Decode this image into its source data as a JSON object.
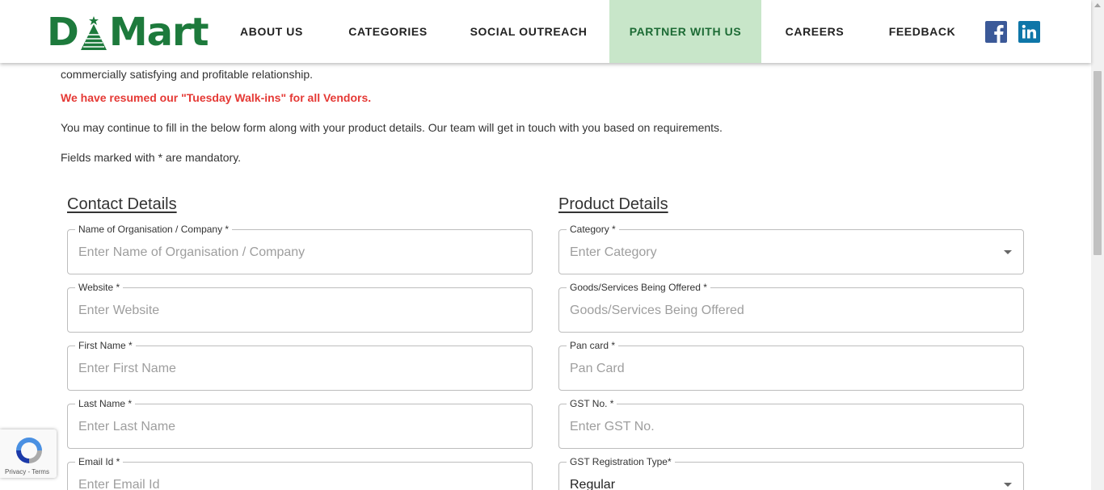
{
  "brand": {
    "logo_left": "D",
    "logo_right": "Mart",
    "primary_color": "#1d7a3c"
  },
  "nav": {
    "items": [
      "ABOUT US",
      "CATEGORIES",
      "SOCIAL OUTREACH",
      "PARTNER WITH US",
      "CAREERS",
      "FEEDBACK"
    ],
    "active": "PARTNER WITH US",
    "active_bg": "#c8e6c9"
  },
  "social": {
    "facebook_icon": "facebook-icon",
    "linkedin_icon": "linkedin-icon",
    "facebook_color": "#3b5998",
    "linkedin_color": "#0e76a8"
  },
  "intro": {
    "line_partial": "commercially satisfying and profitable relationship.",
    "notice": "We have resumed our \"Tuesday Walk-ins\" for all Vendors.",
    "instructions": "You may continue to fill in the below form along with your product details. Our team will get in touch with you based on requirements.",
    "mandatory_note": "Fields marked with * are mandatory."
  },
  "contact_details": {
    "title": "Contact Details",
    "fields": [
      {
        "label": "Name of Organisation / Company *",
        "placeholder": "Enter Name of Organisation / Company",
        "value": ""
      },
      {
        "label": "Website *",
        "placeholder": "Enter Website",
        "value": ""
      },
      {
        "label": "First Name *",
        "placeholder": "Enter First Name",
        "value": ""
      },
      {
        "label": "Last Name *",
        "placeholder": "Enter Last Name",
        "value": ""
      },
      {
        "label": "Email Id *",
        "placeholder": "Enter Email Id",
        "value": ""
      }
    ]
  },
  "product_details": {
    "title": "Product Details",
    "fields": [
      {
        "label": "Category *",
        "placeholder": "Enter Category",
        "value": ""
      },
      {
        "label": "Goods/Services Being Offered *",
        "placeholder": "Goods/Services Being Offered",
        "value": ""
      },
      {
        "label": "Pan card *",
        "placeholder": "Pan Card",
        "value": ""
      },
      {
        "label": "GST No. *",
        "placeholder": "Enter GST No.",
        "value": ""
      },
      {
        "label": "GST Registration Type*",
        "placeholder": "",
        "value": "Regular"
      }
    ]
  },
  "recaptcha": {
    "links": "Privacy - Terms"
  }
}
